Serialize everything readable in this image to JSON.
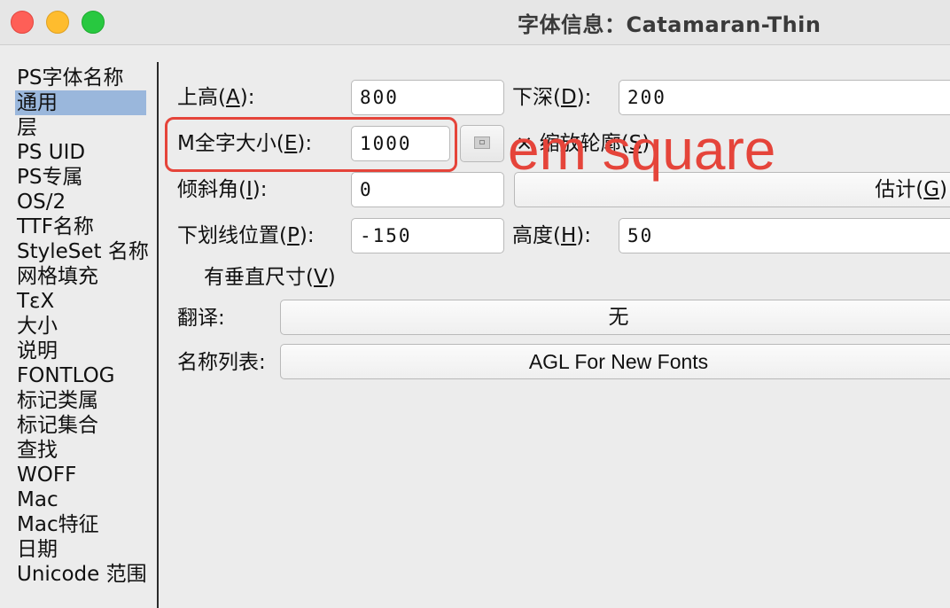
{
  "window": {
    "title": "字体信息：Catamaran-Thin"
  },
  "sidebar": {
    "items": [
      {
        "label": "PS字体名称"
      },
      {
        "label": "通用",
        "selected": true
      },
      {
        "label": "层"
      },
      {
        "label": "PS UID"
      },
      {
        "label": "PS专属"
      },
      {
        "label": "OS/2"
      },
      {
        "label": "TTF名称"
      },
      {
        "label": "StyleSet 名称"
      },
      {
        "label": "网格填充"
      },
      {
        "label": "TεX"
      },
      {
        "label": "大小"
      },
      {
        "label": "说明"
      },
      {
        "label": "FONTLOG"
      },
      {
        "label": "标记类属"
      },
      {
        "label": "标记集合"
      },
      {
        "label": "查找"
      },
      {
        "label": "WOFF"
      },
      {
        "label": "Mac"
      },
      {
        "label": "Mac特征"
      },
      {
        "label": "日期"
      },
      {
        "label": "Unicode 范围"
      }
    ]
  },
  "form": {
    "ascent": {
      "pre": "上高(",
      "key": "A",
      "post": "):",
      "value": "800"
    },
    "descent": {
      "pre": "下深(",
      "key": "D",
      "post": "):",
      "value": "200"
    },
    "em_size": {
      "pre": "M全字大小(",
      "key": "E",
      "post": "):",
      "value": "1000"
    },
    "scale_outlines": {
      "mark": "×",
      "pre": "缩放轮廓(",
      "key": "S",
      "post": ")"
    },
    "italic_angle": {
      "pre": "倾斜角(",
      "key": "I",
      "post": "):",
      "value": "0"
    },
    "guess_button": {
      "pre": "估计(",
      "key": "G",
      "post": ")"
    },
    "underline_position": {
      "pre": "下划线位置(",
      "key": "P",
      "post": "):",
      "value": "-150"
    },
    "underline_height": {
      "pre": "高度(",
      "key": "H",
      "post": "):",
      "value": "50"
    },
    "has_vertical": {
      "pre": "有垂直尺寸(",
      "key": "V",
      "post": ")"
    },
    "interpretation": {
      "label": "翻译:",
      "value": "无"
    },
    "namelist": {
      "label": "名称列表:",
      "value": "AGL For New Fonts"
    }
  },
  "annotation": {
    "text": "em square",
    "color": "#e5443a"
  },
  "colors": {
    "selection": "#9ab7dc",
    "close": "#fe5f57",
    "minimize": "#febc2e",
    "maximize": "#28c840"
  }
}
